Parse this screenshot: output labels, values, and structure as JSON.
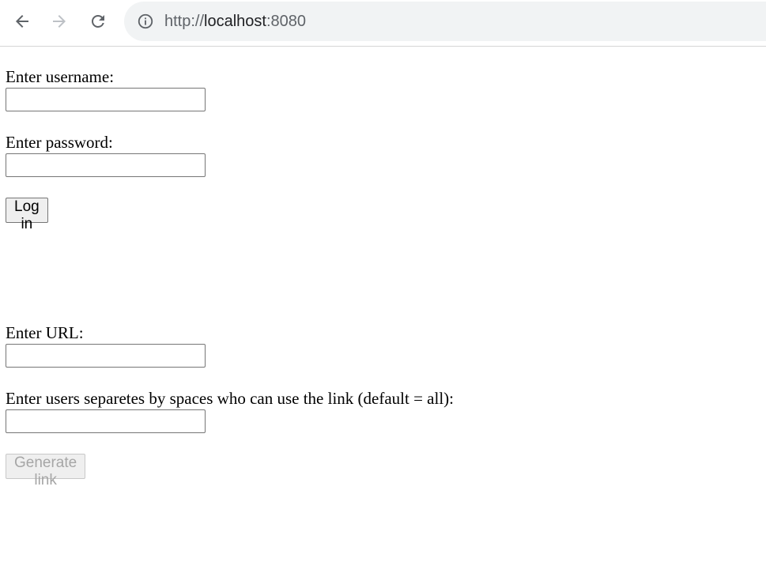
{
  "browser": {
    "url_scheme": "http://",
    "url_host": "localhost",
    "url_port": ":8080"
  },
  "login": {
    "username_label": "Enter username:",
    "username_value": "",
    "password_label": "Enter password:",
    "password_value": "",
    "login_button": "Log in"
  },
  "link": {
    "url_label": "Enter URL:",
    "url_value": "",
    "users_label": "Enter users separetes by spaces who can use the link (default = all):",
    "users_value": "",
    "generate_button": "Generate link",
    "generate_enabled": false
  },
  "icons": {
    "back": "arrow-left-icon",
    "forward": "arrow-right-icon",
    "reload": "reload-icon",
    "site_info": "info-icon"
  }
}
